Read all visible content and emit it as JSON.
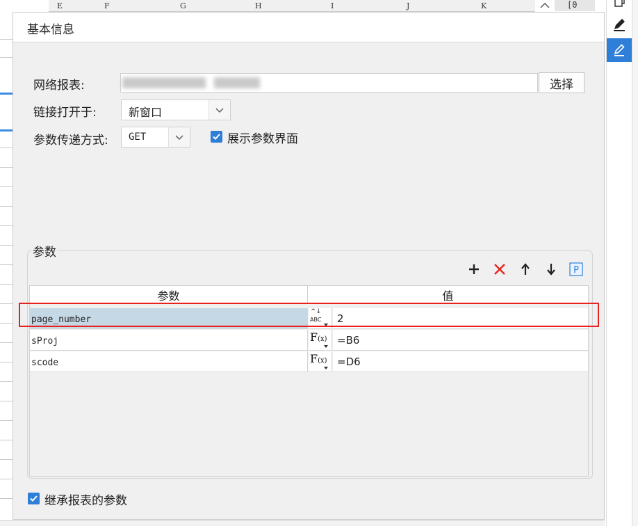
{
  "sheet": {
    "columns": [
      "E",
      "F",
      "G",
      "H",
      "I",
      "J",
      "K"
    ],
    "top_right_label": "[0"
  },
  "dialog": {
    "title": "基本信息",
    "report": {
      "label": "网络报表:",
      "select_button": "选择"
    },
    "link_open": {
      "label": "链接打开于:",
      "value": "新窗口"
    },
    "param_pass": {
      "label": "参数传递方式:",
      "value": "GET"
    },
    "show_param_ui": {
      "label": "展示参数界面",
      "checked": true
    },
    "params_group": {
      "title": "参数",
      "toolbar": [
        "add-icon",
        "delete-icon",
        "move-up-icon",
        "move-down-icon",
        "parameter-p-icon"
      ],
      "columns": [
        "参数",
        "值"
      ],
      "rows": [
        {
          "name": "page_number",
          "type": "abc-text-icon",
          "value": "2",
          "selected": true
        },
        {
          "name": "sProj",
          "type": "formula-fx-icon",
          "value": "=B6",
          "selected": false
        },
        {
          "name": "scode",
          "type": "formula-fx-icon",
          "value": "=D6",
          "selected": false
        }
      ],
      "fx_label": "F",
      "fx_sub": "(x)",
      "abc_top": "^↓",
      "abc_bottom": "ABC"
    },
    "inherit_params": {
      "label": "继承报表的参数",
      "checked": true
    }
  },
  "colors": {
    "accent": "#2f7ed8",
    "highlight": "#e8231f",
    "selected_row": "#c5d8e6"
  }
}
